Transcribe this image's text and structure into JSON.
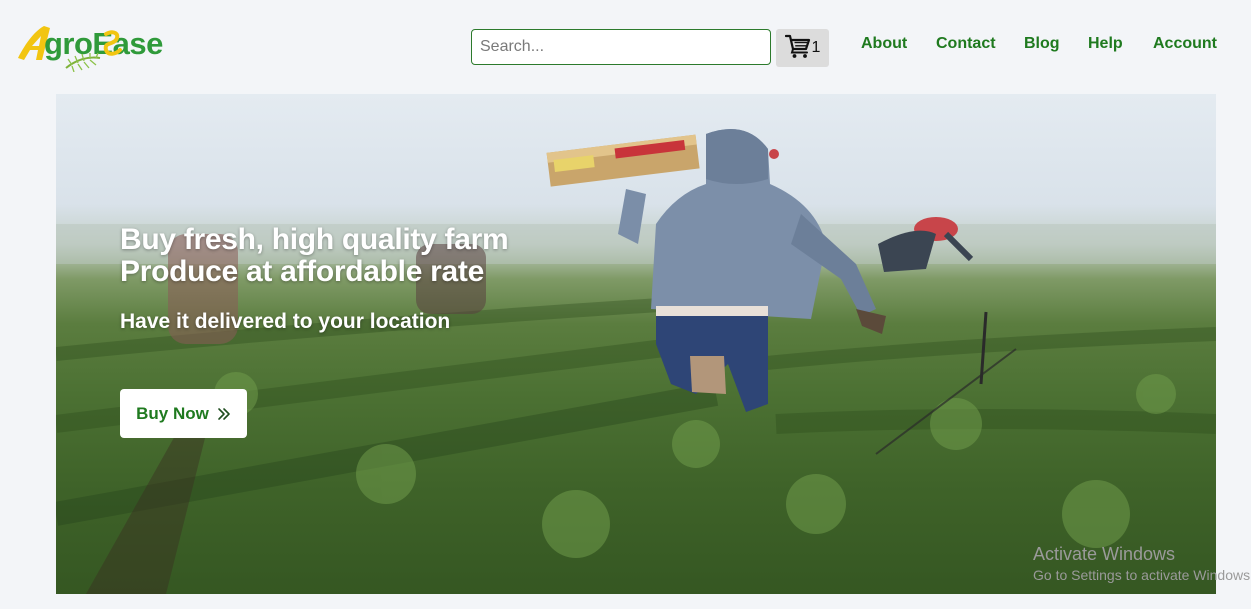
{
  "brand": {
    "logo_text": "AgroEase",
    "colors": {
      "green": "#2f9a3a",
      "yellow": "#f2c511"
    }
  },
  "header": {
    "search": {
      "placeholder": "Search...",
      "value": ""
    },
    "cart": {
      "icon": "cart-icon",
      "count": "1"
    },
    "nav": [
      "About",
      "Contact",
      "Blog",
      "Help",
      "Account"
    ]
  },
  "hero": {
    "title_line1": "Buy fresh, high quality farm",
    "title_line2": "Produce at affordable rate",
    "subtitle": "Have it delivered to your location",
    "cta": {
      "label": "Buy Now",
      "icon": "double-chevron-right-icon"
    }
  },
  "watermark": {
    "title": "Activate Windows",
    "subtitle": "Go to Settings to activate Windows."
  },
  "theme": {
    "accent": "#1f7a1f",
    "background": "#f3f5f8"
  }
}
